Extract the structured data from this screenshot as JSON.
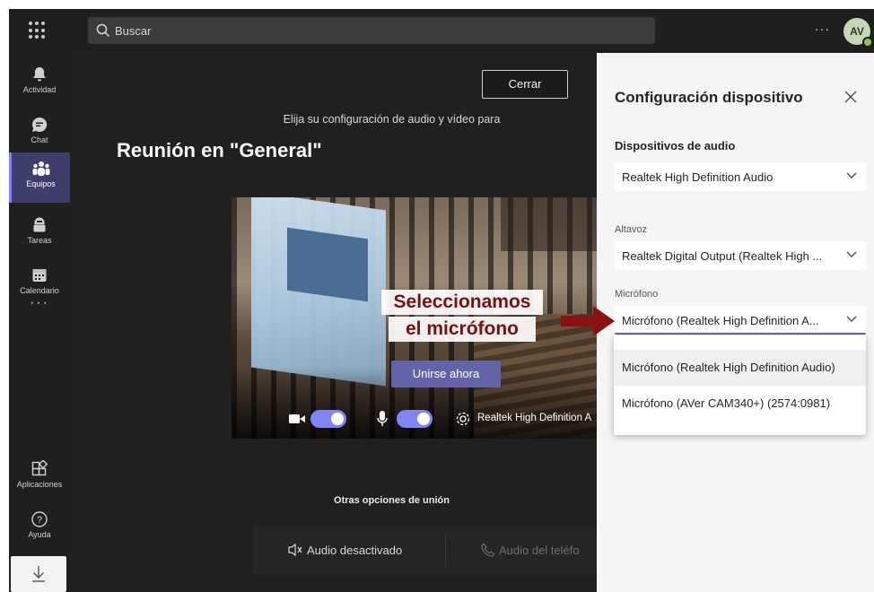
{
  "search": {
    "placeholder": "Buscar"
  },
  "header": {
    "more_label": "···",
    "avatar_initials": "AV"
  },
  "rail": {
    "items": [
      {
        "label": "Actividad",
        "icon": "bell-icon"
      },
      {
        "label": "Chat",
        "icon": "chat-icon"
      },
      {
        "label": "Equipos",
        "icon": "teams-icon",
        "active": true
      },
      {
        "label": "Tareas",
        "icon": "tasks-icon"
      },
      {
        "label": "Calendario",
        "icon": "calendar-icon"
      },
      {
        "label": "Aplicaciones",
        "icon": "apps-icon"
      },
      {
        "label": "Ayuda",
        "icon": "help-icon"
      }
    ],
    "more_label": "···"
  },
  "main": {
    "close_label": "Cerrar",
    "choose_text": "Elija su configuración de audio y vídeo para",
    "meeting_title": "Reunión en \"General\"",
    "join_label": "Unirse ahora",
    "device_name": "Realtek High Definition A",
    "other_options_title": "Otras opciones de unión",
    "audio_off_label": "Audio desactivado",
    "audio_phone_label": "Audio del teléfo"
  },
  "annotation": {
    "line1": "Seleccionamos",
    "line2": "el micrófono"
  },
  "panel": {
    "title": "Configuración dispositivo",
    "audio_devices_label": "Dispositivos de audio",
    "audio_devices_value": "Realtek High Definition Audio",
    "speaker_label": "Altavoz",
    "speaker_value": "Realtek Digital Output (Realtek High ...",
    "mic_label": "Micrófono",
    "mic_value": "Micrófono (Realtek High Definition A...",
    "mic_options": [
      "Micrófono (Realtek High Definition Audio)",
      "Micrófono (AVer CAM340+) (2574:0981)"
    ]
  },
  "colors": {
    "accent": "#6264a7",
    "rail_active": "#3d3e6b",
    "annotation": "#7a1010"
  }
}
